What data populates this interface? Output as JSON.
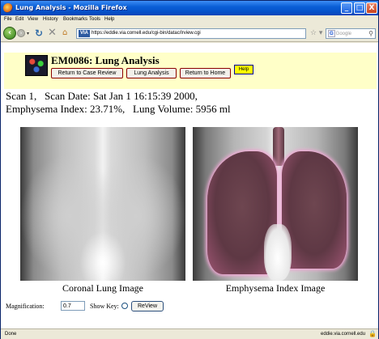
{
  "window": {
    "title": "Lung Analysis - Mozilla Firefox",
    "minimize_glyph": "_",
    "maximize_glyph": "□",
    "close_glyph": "X"
  },
  "menu": [
    "File",
    "Edit",
    "View",
    "History",
    "Bookmarks",
    "Tools",
    "Help"
  ],
  "nav": {
    "url": "https://eddie.via.cornell.edu/cgi-bin/datac/lrview.cgi",
    "site_badge": "VIA",
    "search_placeholder": "Google",
    "search_engine": "G"
  },
  "page": {
    "title": "EM0086: Lung Analysis",
    "buttons": {
      "case_review": "Return to Case Review",
      "lung_analysis": "Lung Analysis",
      "home": "Return to Home",
      "help": "Help"
    },
    "info_line1": "Scan 1,   Scan Date: Sat Jan 1 16:15:39 2000,",
    "info_line2": "Emphysema Index: 23.71%,   Lung Volume: 5956 ml",
    "captions": {
      "coronal": "Coronal Lung Image",
      "emphysema": "Emphysema Index Image"
    },
    "controls": {
      "magnification_label": "Magnification:",
      "magnification_value": "0.7",
      "show_key_label": "Show Key:",
      "review_button": "ReView"
    }
  },
  "status": {
    "left": "Done",
    "host": "eddie.via.cornell.edu"
  },
  "colors": {
    "header_bg": "#ffffc8",
    "help_bg": "#ffff00",
    "emphysema_overlay": "#ef8fc4"
  }
}
